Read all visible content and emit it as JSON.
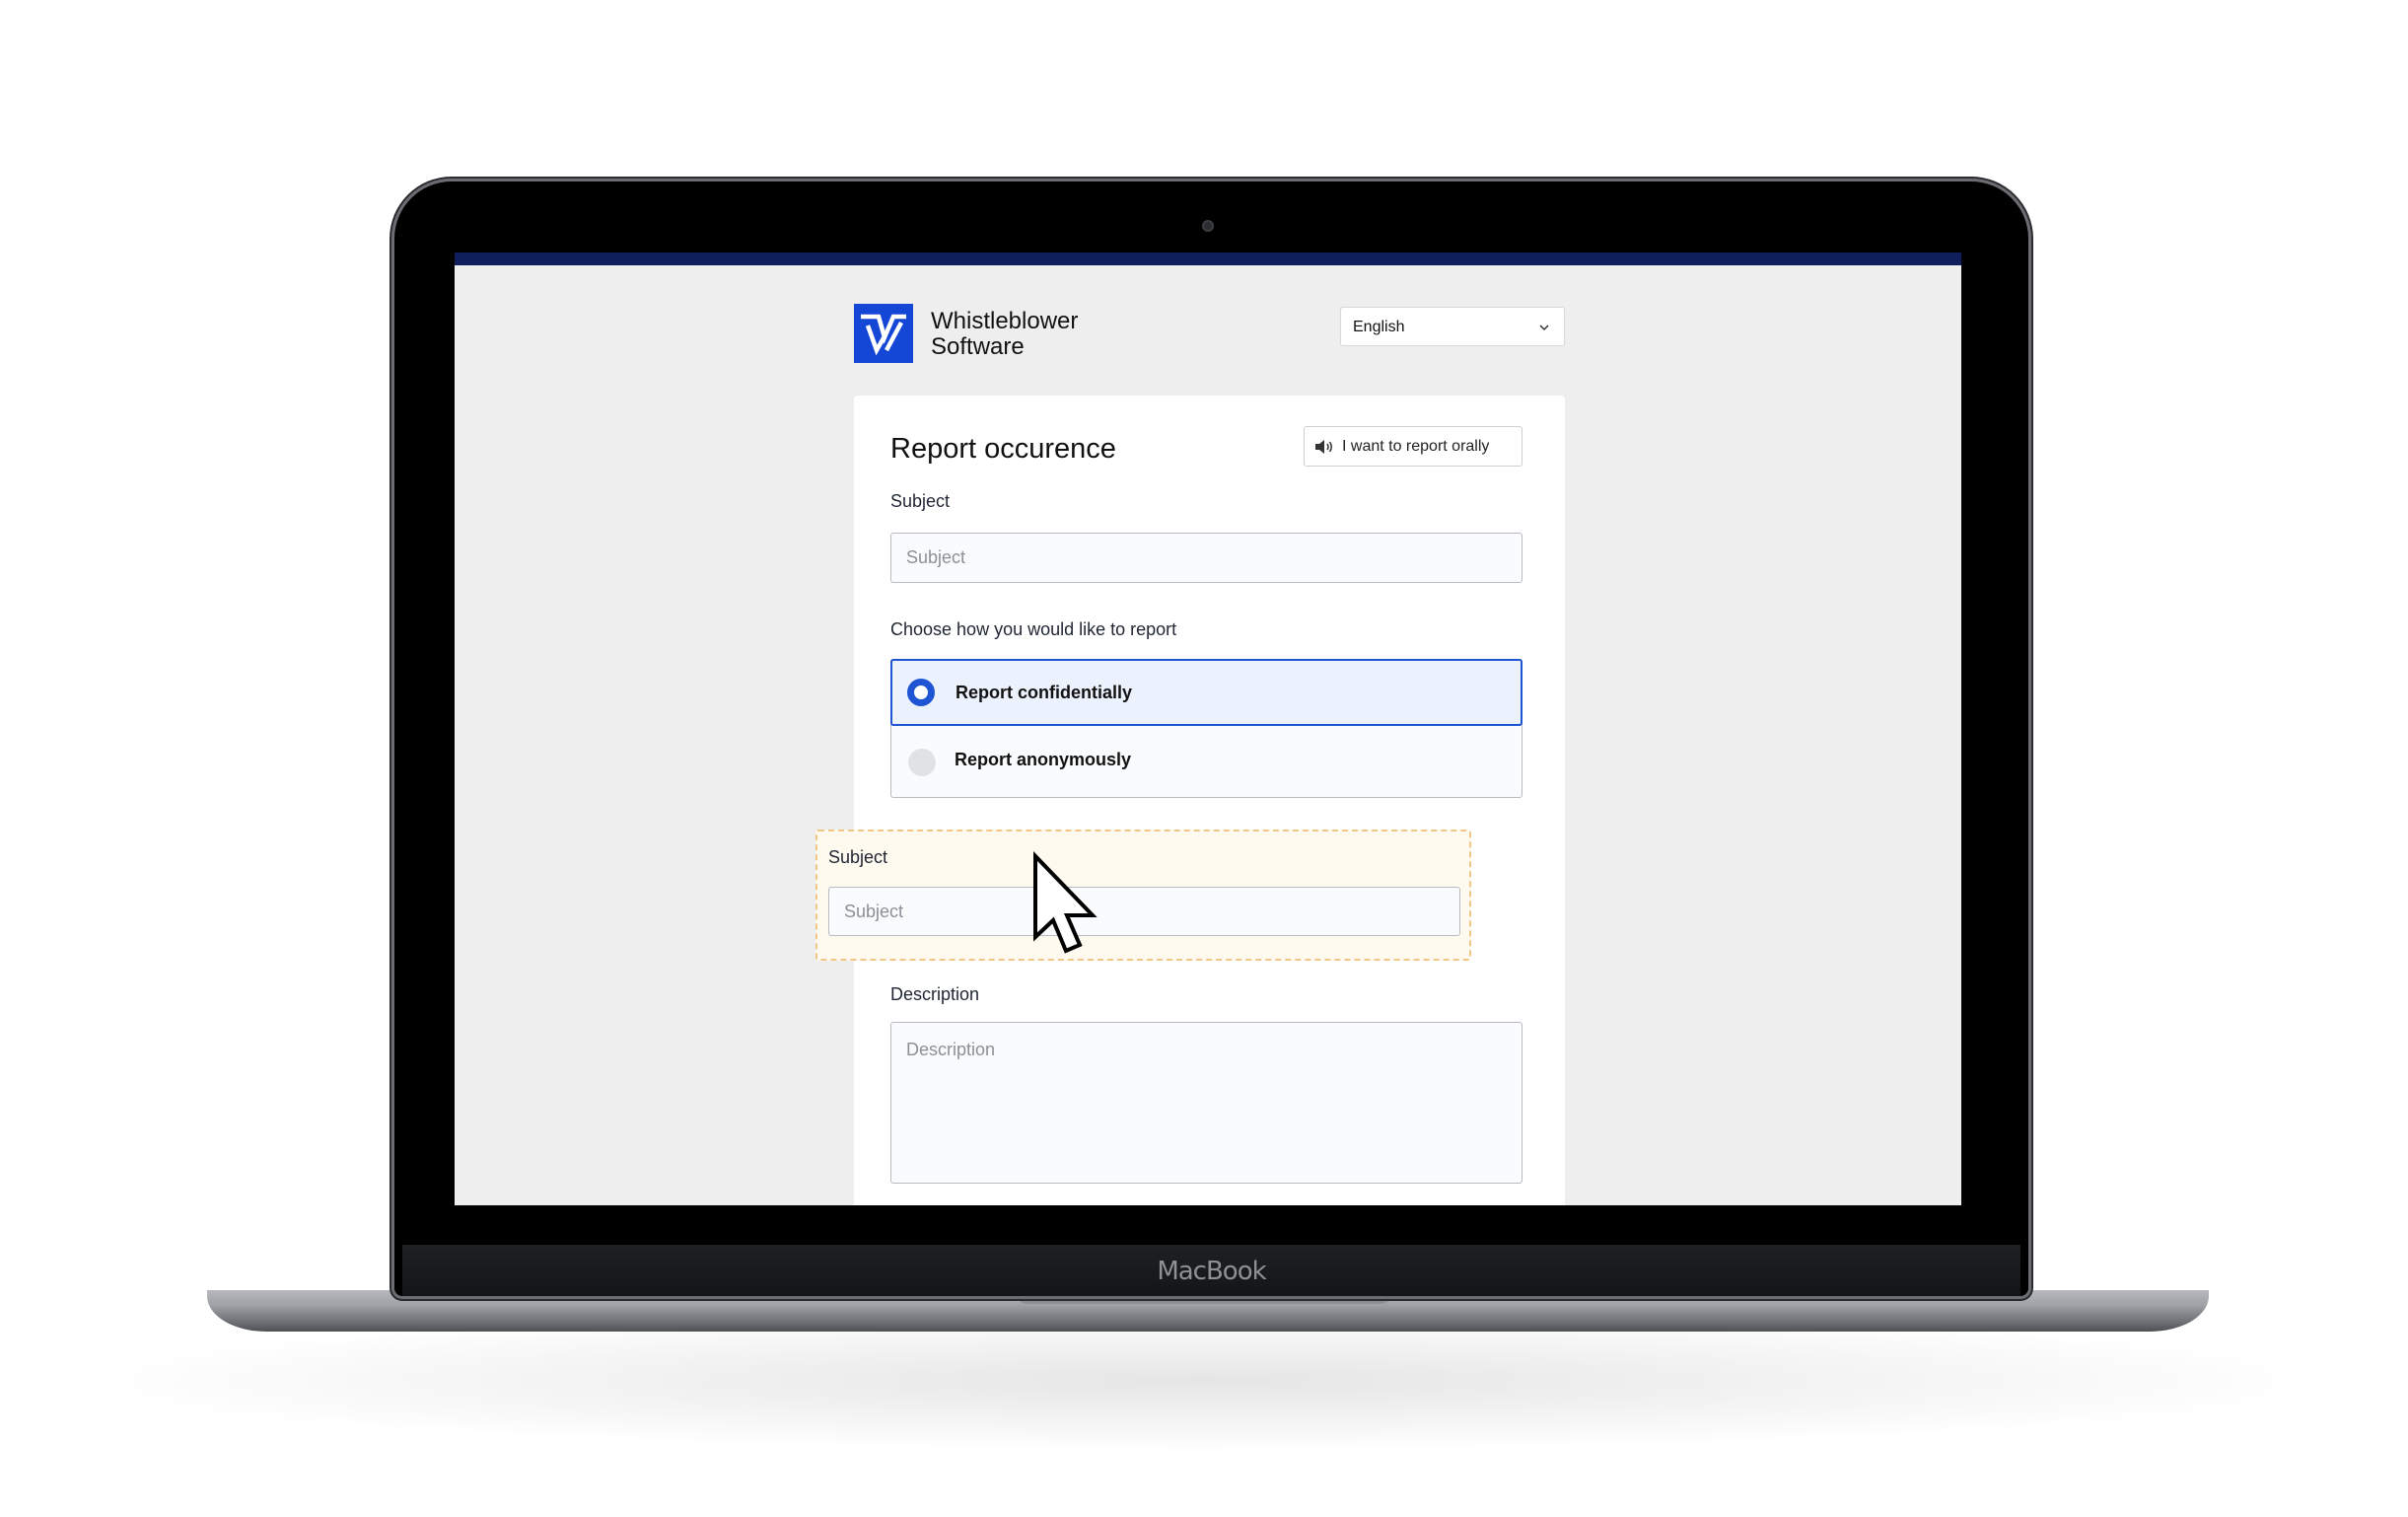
{
  "device": {
    "label": "MacBook"
  },
  "header": {
    "brand_line1": "Whistleblower",
    "brand_line2": "Software",
    "language": "English",
    "brand_color": "#1447d6",
    "topbar_color": "#0e1f5b"
  },
  "form": {
    "title": "Report occurence",
    "oral_button": "I want to report orally",
    "subject_label": "Subject",
    "subject_placeholder": "Subject",
    "choose_label": "Choose how you would like to report",
    "options": [
      {
        "label": "Report confidentially",
        "selected": true
      },
      {
        "label": "Report anonymously",
        "selected": false
      }
    ],
    "dragged_field": {
      "label": "Subject",
      "placeholder": "Subject"
    },
    "description_label": "Description",
    "description_placeholder": "Description",
    "accent_color": "#1f54d2"
  },
  "icons": {
    "logo": "whistleblower-logo-icon",
    "language_chevron": "chevron-down-icon",
    "oral": "speaker-icon",
    "pointer": "mouse-pointer-icon"
  }
}
